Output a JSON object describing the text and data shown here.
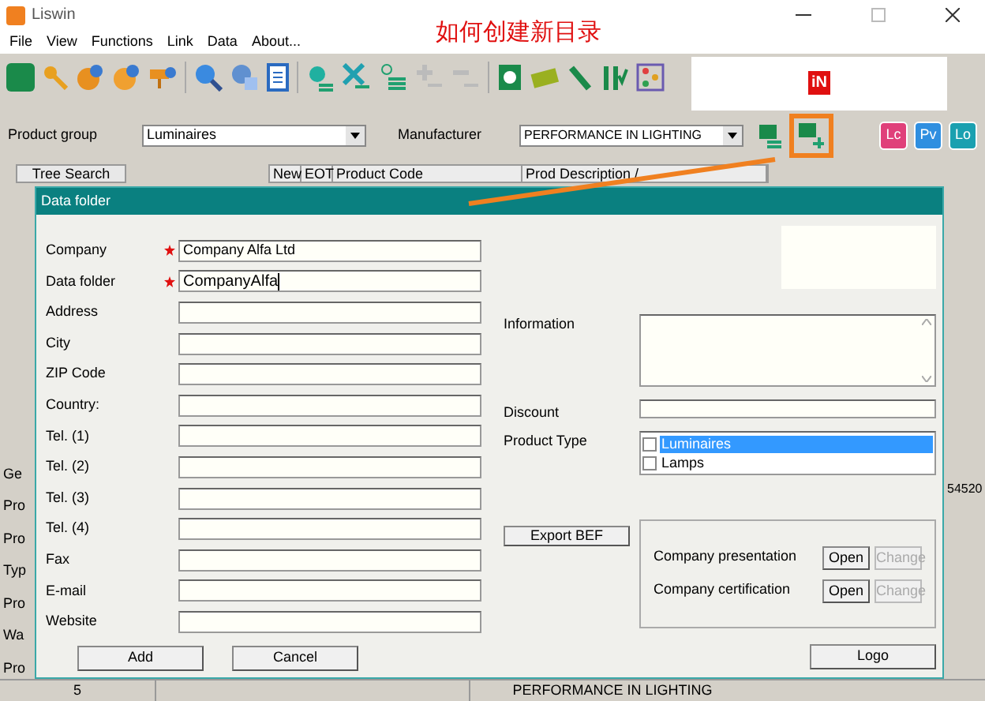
{
  "window": {
    "title": "Liswin"
  },
  "menu": [
    "File",
    "View",
    "Functions",
    "Link",
    "Data",
    "About..."
  ],
  "annotation": "如何创建新目录",
  "brand_logo": "iN",
  "filters": [
    {
      "label": "Product group",
      "value": "Luminaires"
    },
    {
      "label": "Manufacturer",
      "value": "PERFORMANCE IN LIGHTING"
    }
  ],
  "view_buttons": [
    {
      "label": "Lc",
      "color": "#e0407a"
    },
    {
      "label": "Pv",
      "color": "#2f8fe0"
    },
    {
      "label": "Lo",
      "color": "#1aa0b0"
    }
  ],
  "search_tab": "Tree Search",
  "table": {
    "columns": [
      "New",
      "EOT",
      "Product Code",
      "Prod Description /"
    ]
  },
  "side_labels": [
    "Ge",
    "Pro",
    "Pro",
    "Typ",
    "Pro",
    "Wa",
    "Pro"
  ],
  "side_number": "54520",
  "status_bar": [
    "5",
    "PERFORMANCE IN LIGHTING"
  ],
  "dialog": {
    "title": "Data folder",
    "fields": [
      {
        "label": "Company",
        "required": true,
        "value": "Company Alfa Ltd",
        "focused": false
      },
      {
        "label": "Data folder",
        "required": true,
        "value": "CompanyAlfa",
        "focused": true
      },
      {
        "label": "Address",
        "required": false,
        "focused": false
      },
      {
        "label": "City",
        "required": false,
        "focused": false
      },
      {
        "label": "ZIP Code",
        "required": false,
        "focused": false
      },
      {
        "label": "Country:",
        "required": false,
        "focused": false
      },
      {
        "label": "Tel. (1)",
        "required": false,
        "focused": false
      },
      {
        "label": "Tel. (2)",
        "required": false,
        "focused": false
      },
      {
        "label": "Tel. (3)",
        "required": false,
        "focused": false
      },
      {
        "label": "Tel. (4)",
        "required": false,
        "focused": false
      },
      {
        "label": "Fax",
        "required": false,
        "focused": false
      },
      {
        "label": "E-mail",
        "required": false,
        "focused": false
      },
      {
        "label": "Website",
        "required": false,
        "focused": false
      }
    ],
    "information": {
      "label": "Information"
    },
    "discount": {
      "label": "Discount"
    },
    "product_type": {
      "label": "Product Type",
      "options": [
        {
          "label": "Luminaires",
          "checked": false,
          "selected": true
        },
        {
          "label": "Lamps",
          "checked": false,
          "selected": false
        }
      ]
    },
    "export_button": "Export BEF",
    "documents": [
      {
        "label": "Company presentation",
        "open": "Open",
        "change": "Change",
        "change_disabled": true
      },
      {
        "label": "Company certification",
        "open": "Open",
        "change": "Change",
        "change_disabled": true
      }
    ],
    "buttons": [
      "Add",
      "Cancel"
    ],
    "logo_button": "Logo"
  }
}
